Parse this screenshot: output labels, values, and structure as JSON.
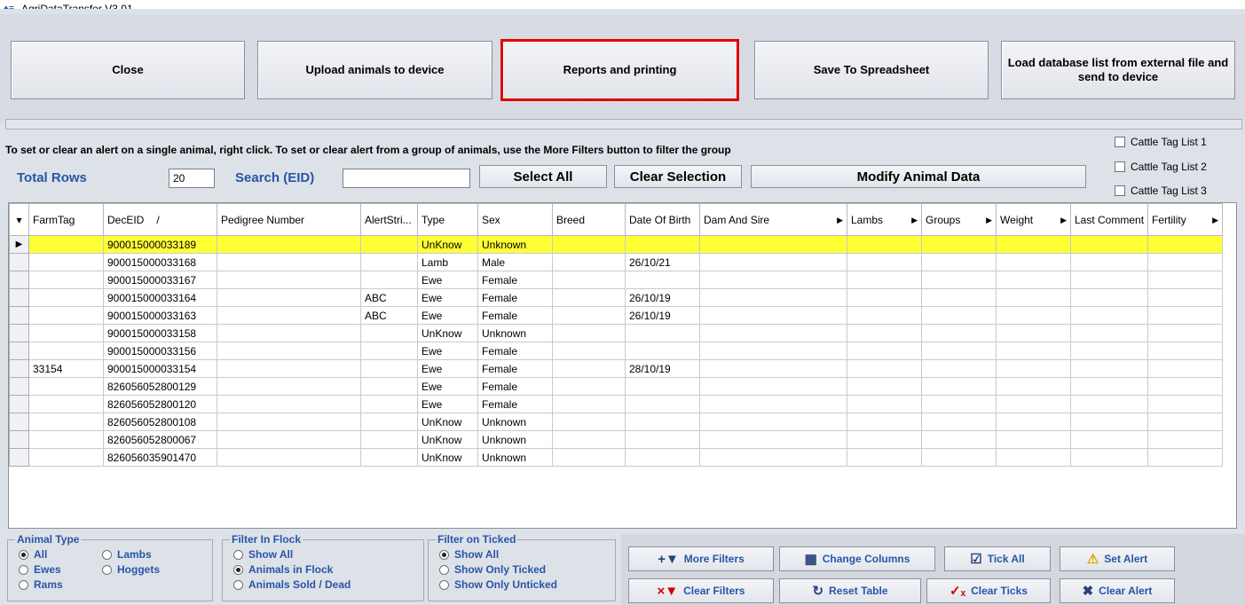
{
  "window": {
    "title": "AgriDataTransfer V3.01"
  },
  "toolbar": {
    "close": "Close",
    "upload": "Upload animals to device",
    "reports": "Reports and printing",
    "save_spreadsheet": "Save To Spreadsheet",
    "load_db": "Load database list from external file and send to device"
  },
  "hint": "To set or clear an alert on a single animal, right click. To set or clear alert from a group of animals, use the More Filters button to filter the group",
  "controls": {
    "total_rows_label": "Total Rows",
    "total_rows_value": "20",
    "search_label": "Search (EID)",
    "search_value": "",
    "select_all": "Select All",
    "clear_selection": "Clear Selection",
    "modify": "Modify Animal Data"
  },
  "cattle_lists": [
    "Cattle Tag List 1",
    "Cattle Tag List 2",
    "Cattle Tag List 3"
  ],
  "table": {
    "columns": [
      "FarmTag",
      "DecEID",
      "Pedigree Number",
      "AlertStri...",
      "Type",
      "Sex",
      "Breed",
      "Date Of Birth",
      "Dam And Sire",
      "Lambs",
      "Groups",
      "Weight",
      "Last Comment",
      "Fertility"
    ],
    "sort_indicator": "/",
    "rows": [
      [
        "",
        "900015000033189",
        "",
        "",
        "UnKnow",
        "Unknown",
        "",
        "",
        "",
        "",
        "",
        "",
        "",
        ""
      ],
      [
        "",
        "900015000033168",
        "",
        "",
        "Lamb",
        "Male",
        "",
        "26/10/21",
        "",
        "",
        "",
        "",
        "",
        ""
      ],
      [
        "",
        "900015000033167",
        "",
        "",
        "Ewe",
        "Female",
        "",
        "",
        "",
        "",
        "",
        "",
        "",
        ""
      ],
      [
        "",
        "900015000033164",
        "",
        "ABC",
        "Ewe",
        "Female",
        "",
        "26/10/19",
        "",
        "",
        "",
        "",
        "",
        ""
      ],
      [
        "",
        "900015000033163",
        "",
        "ABC",
        "Ewe",
        "Female",
        "",
        "26/10/19",
        "",
        "",
        "",
        "",
        "",
        ""
      ],
      [
        "",
        "900015000033158",
        "",
        "",
        "UnKnow",
        "Unknown",
        "",
        "",
        "",
        "",
        "",
        "",
        "",
        ""
      ],
      [
        "",
        "900015000033156",
        "",
        "",
        "Ewe",
        "Female",
        "",
        "",
        "",
        "",
        "",
        "",
        "",
        ""
      ],
      [
        "33154",
        "900015000033154",
        "",
        "",
        "Ewe",
        "Female",
        "",
        "28/10/19",
        "",
        "",
        "",
        "",
        "",
        ""
      ],
      [
        "",
        "826056052800129",
        "",
        "",
        "Ewe",
        "Female",
        "",
        "",
        "",
        "",
        "",
        "",
        "",
        ""
      ],
      [
        "",
        "826056052800120",
        "",
        "",
        "Ewe",
        "Female",
        "",
        "",
        "",
        "",
        "",
        "",
        "",
        ""
      ],
      [
        "",
        "826056052800108",
        "",
        "",
        "UnKnow",
        "Unknown",
        "",
        "",
        "",
        "",
        "",
        "",
        "",
        ""
      ],
      [
        "",
        "826056052800067",
        "",
        "",
        "UnKnow",
        "Unknown",
        "",
        "",
        "",
        "",
        "",
        "",
        "",
        ""
      ],
      [
        "",
        "826056035901470",
        "",
        "",
        "UnKnow",
        "Unknown",
        "",
        "",
        "",
        "",
        "",
        "",
        "",
        ""
      ]
    ]
  },
  "filters": {
    "animal_type": {
      "legend": "Animal Type",
      "all": "All",
      "lambs": "Lambs",
      "ewes": "Ewes",
      "hoggets": "Hoggets",
      "rams": "Rams"
    },
    "in_flock": {
      "legend": "Filter In Flock",
      "show_all": "Show All",
      "in_flock": "Animals in Flock",
      "sold": "Animals Sold / Dead"
    },
    "ticked": {
      "legend": "Filter on Ticked",
      "show_all": "Show All",
      "only_ticked": "Show Only Ticked",
      "only_unticked": "Show Only Unticked"
    }
  },
  "actions": {
    "more_filters": "More Filters",
    "change_columns": "Change Columns",
    "tick_all": "Tick All",
    "set_alert": "Set Alert",
    "clear_filters": "Clear Filters",
    "reset_table": "Reset Table",
    "clear_ticks": "Clear Ticks",
    "clear_alert": "Clear Alert"
  }
}
